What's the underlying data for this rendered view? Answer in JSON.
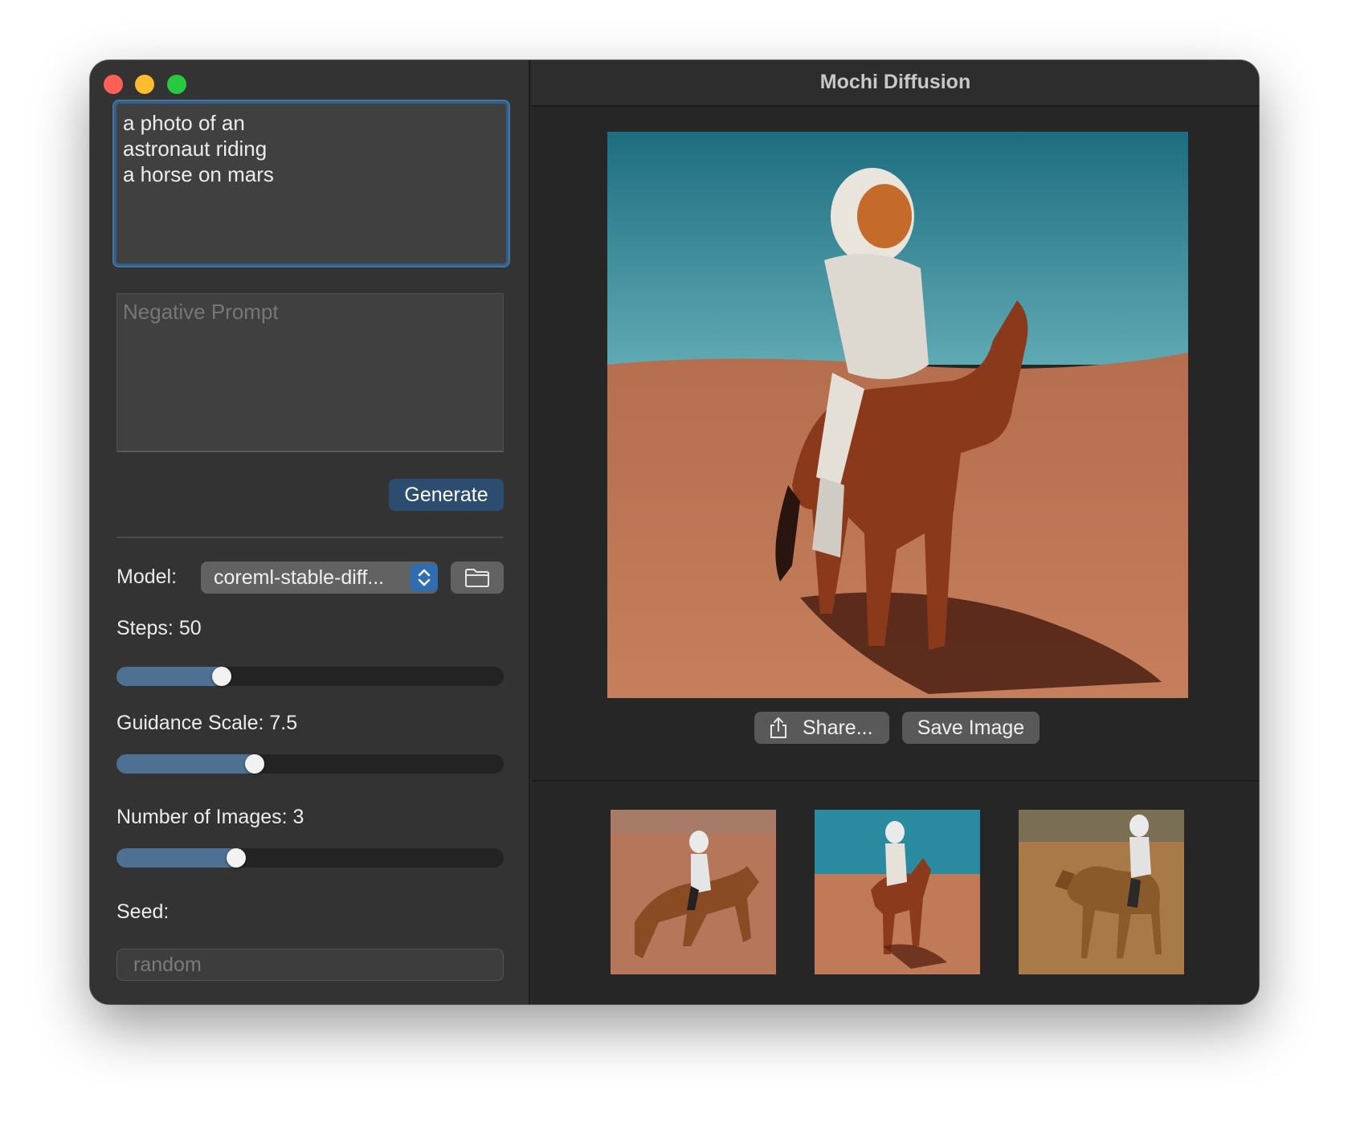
{
  "window": {
    "title": "Mochi Diffusion"
  },
  "sidebar": {
    "prompt_text": "a photo of an\nastronaut riding\na horse on mars",
    "negative_prompt_placeholder": "Negative Prompt",
    "generate_label": "Generate",
    "model_label": "Model:",
    "model_value": "coreml-stable-diff...",
    "steps_label": "Steps: 50",
    "steps_fraction": 0.26,
    "guidance_label": "Guidance Scale: 7.5",
    "guidance_fraction": 0.35,
    "num_images_label": "Number of Images: 3",
    "num_images_fraction": 0.3,
    "seed_label": "Seed:",
    "seed_placeholder": "random"
  },
  "viewer": {
    "share_label": "Share...",
    "save_label": "Save Image",
    "thumbnails": [
      "thumbnail-1",
      "thumbnail-2",
      "thumbnail-3"
    ]
  },
  "colors": {
    "accent": "#2f6db2",
    "generate_button": "#2c4d6f",
    "slider_fill": "#4e7193",
    "close": "#fe5f57",
    "minimize": "#febc2e",
    "maximize": "#28c840"
  }
}
